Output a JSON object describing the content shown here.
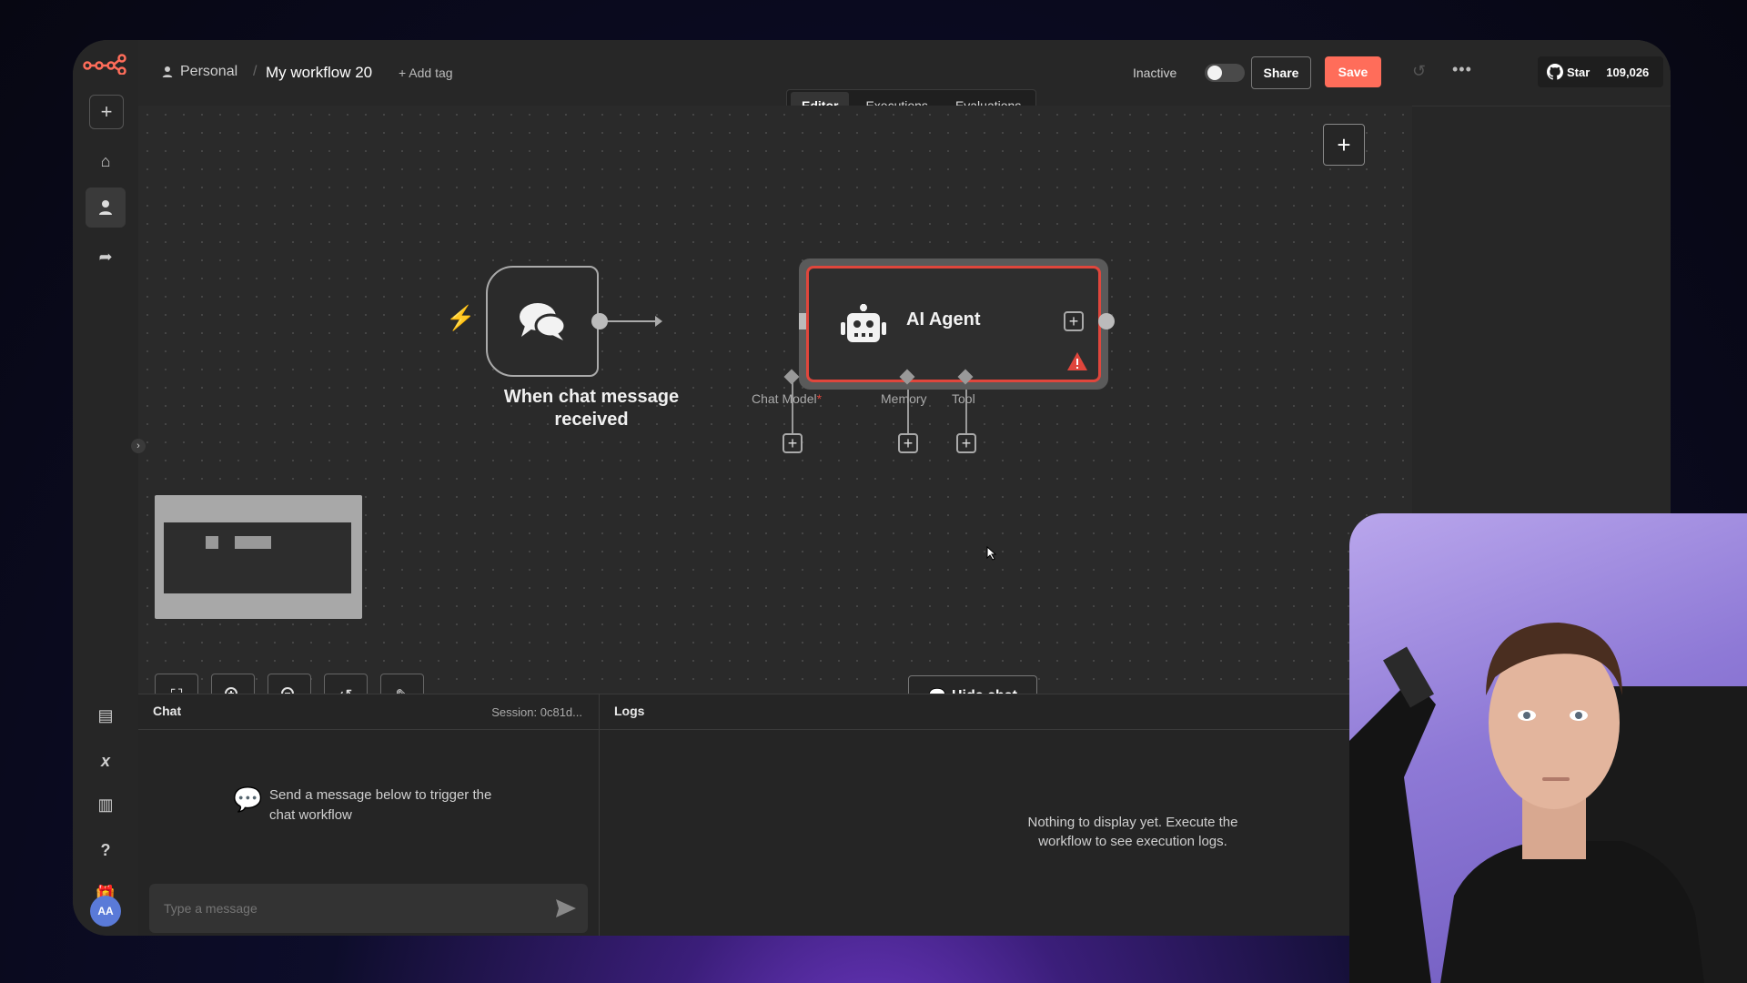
{
  "header": {
    "project": "Personal",
    "workflow_name": "My workflow 20",
    "add_tag": "+ Add tag",
    "status_label": "Inactive",
    "share_label": "Share",
    "save_label": "Save",
    "github_star": "Star",
    "github_count": "109,026"
  },
  "tabs": [
    "Editor",
    "Executions",
    "Evaluations"
  ],
  "nodes": {
    "trigger_label": "When chat message received",
    "agent_label": "AI Agent",
    "ports": {
      "chat_model": "Chat Model",
      "chat_model_required": "*",
      "memory": "Memory",
      "tool": "Tool"
    }
  },
  "hide_chat": "Hide chat",
  "chat_panel": {
    "title": "Chat",
    "session": "Session: 0c81d...",
    "empty_message": "Send a message below to trigger the chat workflow",
    "input_placeholder": "Type a message"
  },
  "logs_panel": {
    "title": "Logs",
    "empty_message": "Nothing to display yet. Execute the workflow to see execution logs."
  },
  "user": {
    "initials": "AA"
  },
  "colors": {
    "accent": "#ff6d5a",
    "warning": "#e0463c"
  },
  "icons": [
    "logo-icon",
    "plus-icon",
    "home-icon",
    "person-icon",
    "share-arrow-icon",
    "templates-icon",
    "variables-icon",
    "insights-icon",
    "help-icon",
    "gift-icon",
    "chat-bubbles-icon",
    "robot-icon",
    "warning-icon",
    "fit-view-icon",
    "zoom-in-icon",
    "zoom-out-icon",
    "reset-zoom-icon",
    "tidy-up-icon",
    "send-icon",
    "github-icon"
  ]
}
